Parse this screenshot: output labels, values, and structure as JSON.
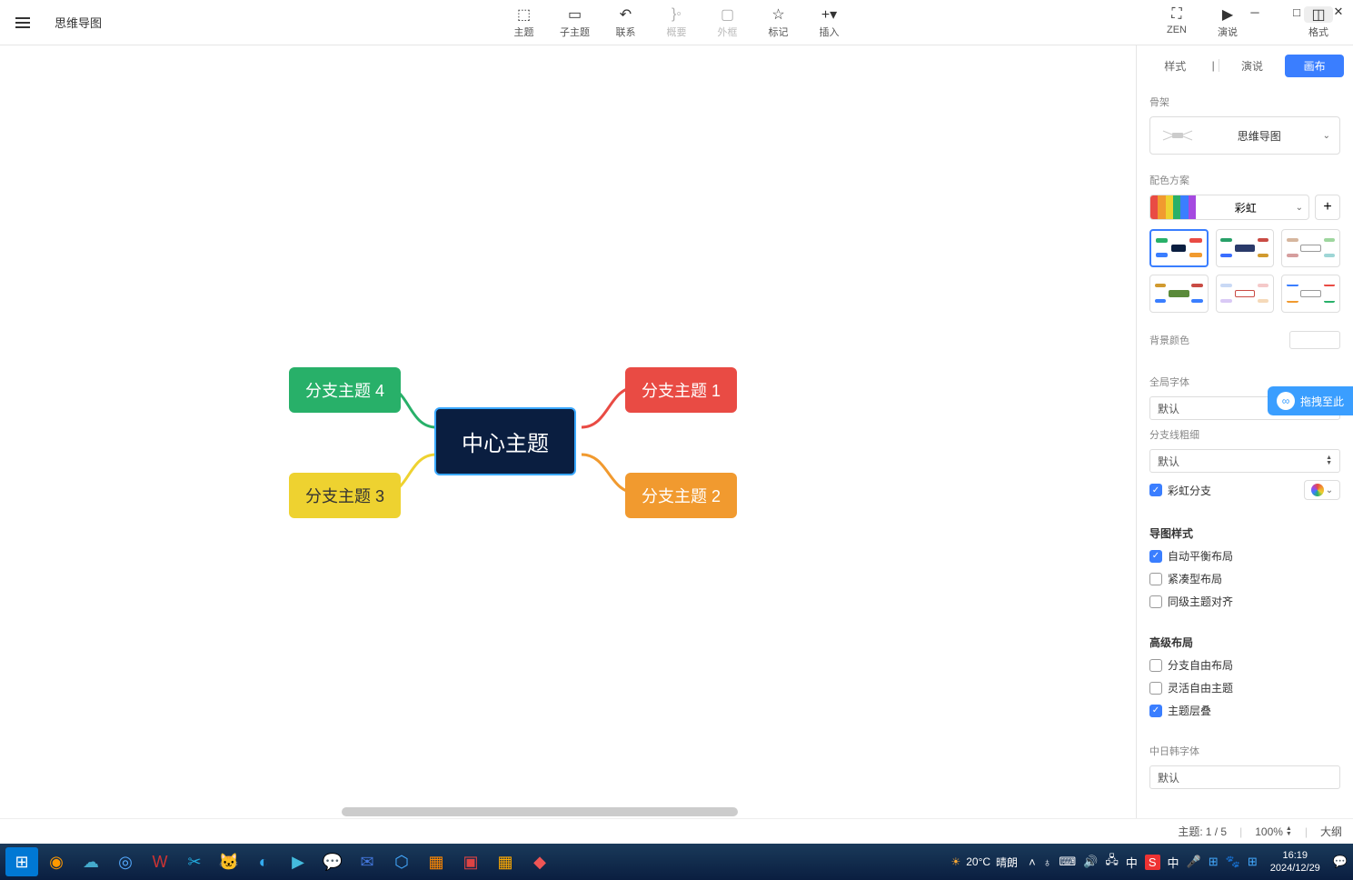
{
  "doc_title": "思维导图",
  "toolbar": {
    "topic": "主题",
    "subtopic": "子主题",
    "relation": "联系",
    "summary": "概要",
    "boundary": "外框",
    "marker": "标记",
    "insert": "插入",
    "zen": "ZEN",
    "pitch": "演说",
    "format": "格式"
  },
  "mindmap": {
    "center": "中心主题",
    "b1": "分支主题 1",
    "b2": "分支主题 2",
    "b3": "分支主题 3",
    "b4": "分支主题 4"
  },
  "sidebar": {
    "tabs": {
      "style": "样式",
      "pitch": "演说",
      "canvas": "画布"
    },
    "skeleton_label": "骨架",
    "skeleton_value": "思维导图",
    "color_scheme_label": "配色方案",
    "color_scheme_value": "彩虹",
    "bg_color_label": "背景颜色",
    "global_font_label": "全局字体",
    "global_font_value": "默认",
    "branch_width_label": "分支线粗细",
    "branch_width_value": "默认",
    "rainbow_branch": "彩虹分支",
    "map_style_title": "导图样式",
    "auto_balance": "自动平衡布局",
    "compact": "紧凑型布局",
    "align_level": "同级主题对齐",
    "advanced_title": "高级布局",
    "free_branch": "分支自由布局",
    "free_topic": "灵活自由主题",
    "overlap": "主题层叠",
    "cjk_font_label": "中日韩字体",
    "cjk_font_value": "默认"
  },
  "statusbar": {
    "topic_label": "主题:",
    "topic_count": "1 / 5",
    "zoom": "100%",
    "outline": "大纲"
  },
  "float": "拖拽至此",
  "taskbar": {
    "weather_temp": "20°C",
    "weather_cond": "晴朗",
    "ime": "中",
    "time": "16:19",
    "date": "2024/12/29"
  }
}
